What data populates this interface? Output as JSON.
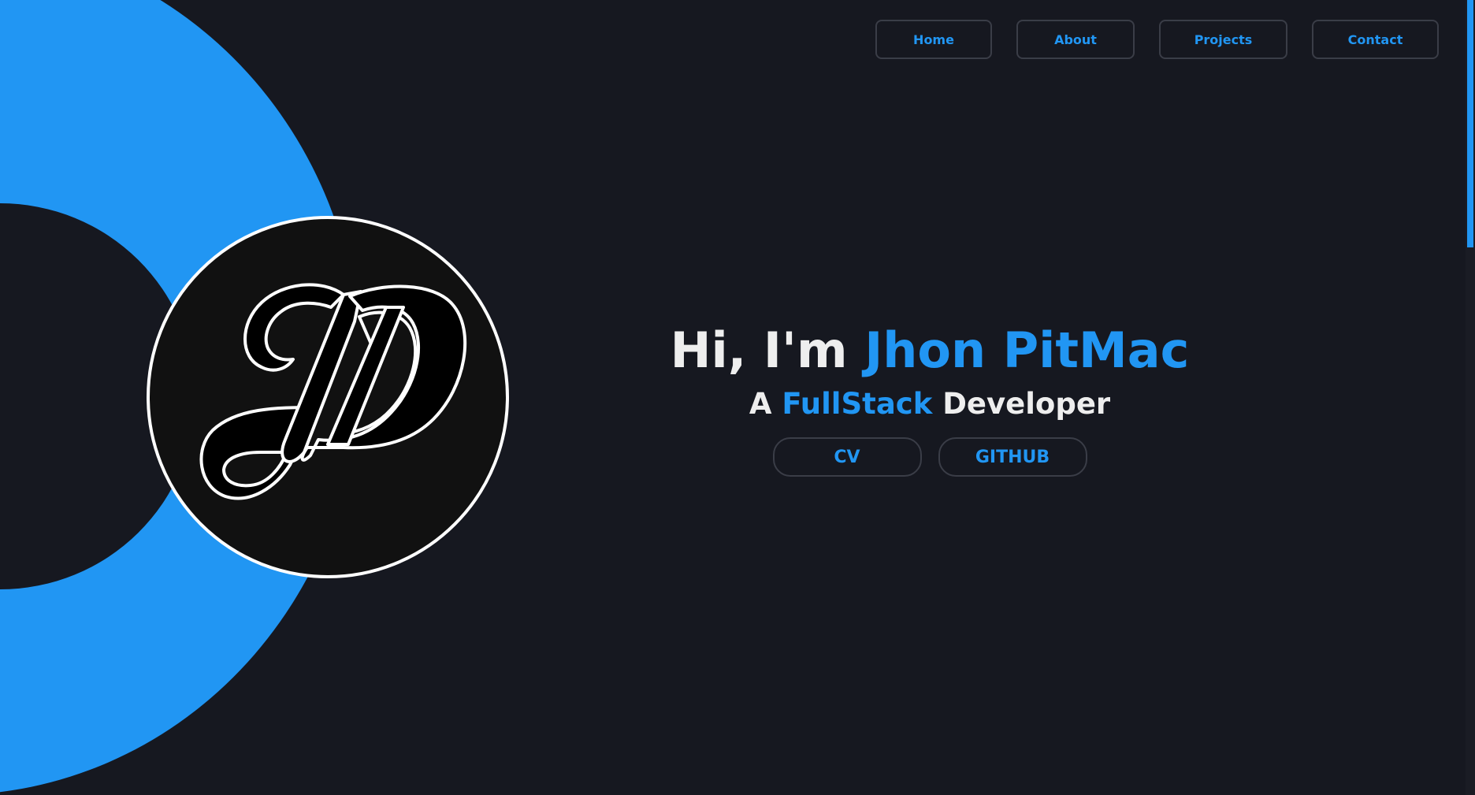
{
  "colors": {
    "background": "#161820",
    "accent": "#2196f3",
    "text": "#eeeeee",
    "logo_bg": "#111111"
  },
  "logo": {
    "icon": "jp-monogram-logo"
  },
  "nav": {
    "items": [
      {
        "label": "Home"
      },
      {
        "label": "About"
      },
      {
        "label": "Projects"
      },
      {
        "label": "Contact"
      }
    ]
  },
  "hero": {
    "greeting": "Hi, I'm",
    "name": "Jhon PitMac",
    "sub_prefix": "A",
    "sub_accent": "FullStack",
    "sub_suffix": "Developer",
    "buttons": [
      {
        "label": "CV"
      },
      {
        "label": "GITHUB"
      }
    ]
  }
}
